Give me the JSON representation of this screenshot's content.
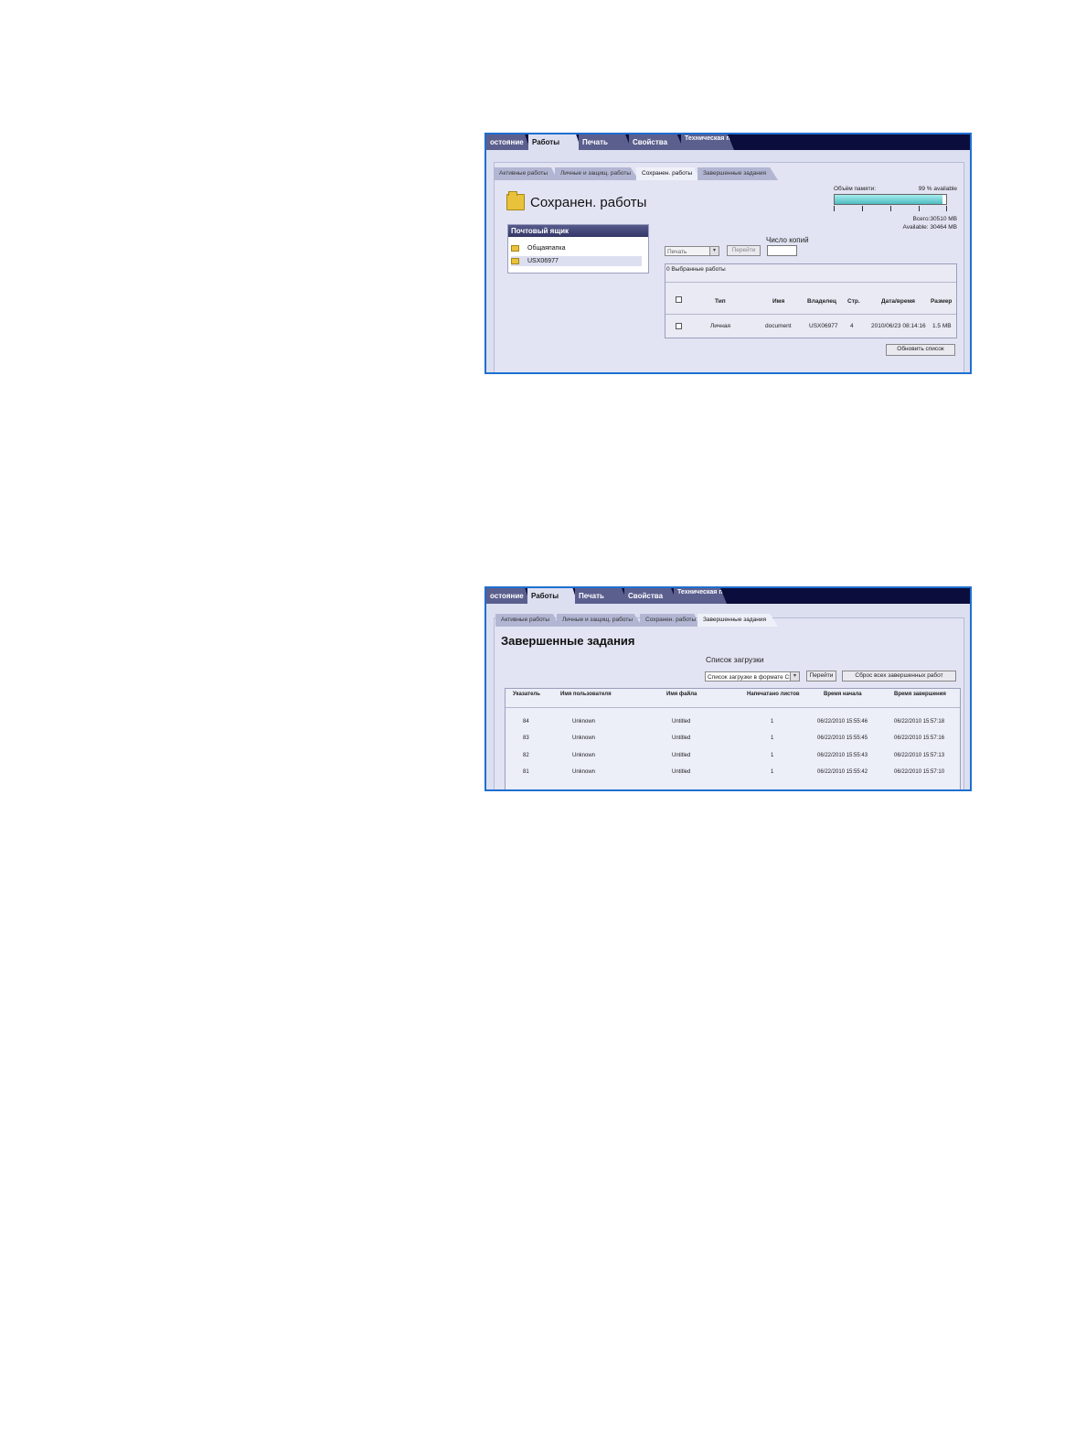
{
  "nav": {
    "tabs": [
      "остояние",
      "Работы",
      "Печать",
      "Свойства",
      "Техническая поддержка"
    ]
  },
  "screen1": {
    "subtabs": [
      "Активные работы",
      "Личные и защищ. работы",
      "Сохранен. работы",
      "Завершенные задания"
    ],
    "title": "Сохранен. работы",
    "mailbox": {
      "header": "Почтовый ящик",
      "items": [
        "Общаяпапка",
        "USX06977"
      ]
    },
    "memory": {
      "label": "Объём памяти:",
      "available_pct": "99 % available",
      "fill_fraction": 0.97,
      "total": "Всего:30510 MB",
      "available": "Available: 30464 MB"
    },
    "copies_label": "Число копий",
    "action_select": "Печать",
    "go_button": "Перейти",
    "selected_jobs": "0 Выбранные работы",
    "columns": [
      "Тип",
      "Имя",
      "Владелец",
      "Стр.",
      "Дата/время",
      "Размер"
    ],
    "rows": [
      [
        "Личная",
        "document",
        "USX06977",
        "4",
        "2010/06/23 08:14:16",
        "1.5 MB"
      ]
    ],
    "refresh_button": "Обновить список"
  },
  "screen2": {
    "subtabs": [
      "Активные работы",
      "Личные и защищ. работы",
      "Сохранен. работы",
      "Завершенные задания"
    ],
    "title": "Завершенные задания",
    "download_label": "Список загрузки",
    "download_select": "Список загрузки в формате CSV",
    "go_button": "Перейти",
    "reset_button": "Сброс всех завершенных работ",
    "columns": [
      "Указатель",
      "Имя пользователя",
      "Имя файла",
      "Напечатано листов",
      "Время начала",
      "Время завершения"
    ],
    "rows": [
      [
        "84",
        "Unknown",
        "Untitled",
        "1",
        "06/22/2010 15:55:46",
        "06/22/2010 15:57:18"
      ],
      [
        "83",
        "Unknown",
        "Untitled",
        "1",
        "06/22/2010 15:55:45",
        "06/22/2010 15:57:16"
      ],
      [
        "82",
        "Unknown",
        "Untitled",
        "1",
        "06/22/2010 15:55:43",
        "06/22/2010 15:57:13"
      ],
      [
        "81",
        "Unknown",
        "Untitled",
        "1",
        "06/22/2010 15:55:42",
        "06/22/2010 15:57:10"
      ]
    ]
  }
}
